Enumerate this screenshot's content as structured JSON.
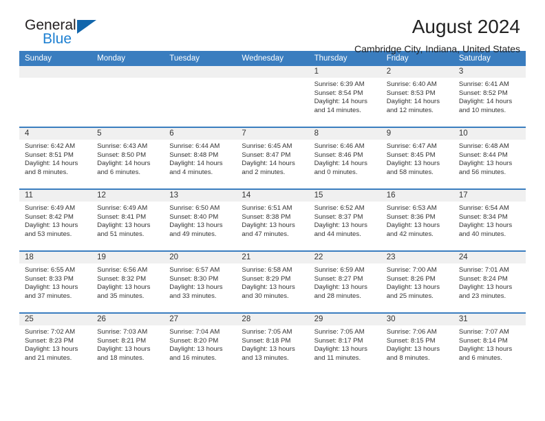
{
  "brand": {
    "name_part1": "General",
    "name_part2": "Blue",
    "flag_color": "#1266ab",
    "blue_color": "#1c7fd1"
  },
  "header": {
    "title": "August 2024",
    "subtitle": "Cambridge City, Indiana, United States",
    "header_bg": "#3a7dbf",
    "header_text_color": "#ffffff"
  },
  "weekday_headers": [
    "Sunday",
    "Monday",
    "Tuesday",
    "Wednesday",
    "Thursday",
    "Friday",
    "Saturday"
  ],
  "weeks": [
    [
      {
        "day": "",
        "sunrise": "",
        "sunset": "",
        "daylight_line1": "",
        "daylight_line2": ""
      },
      {
        "day": "",
        "sunrise": "",
        "sunset": "",
        "daylight_line1": "",
        "daylight_line2": ""
      },
      {
        "day": "",
        "sunrise": "",
        "sunset": "",
        "daylight_line1": "",
        "daylight_line2": ""
      },
      {
        "day": "",
        "sunrise": "",
        "sunset": "",
        "daylight_line1": "",
        "daylight_line2": ""
      },
      {
        "day": "1",
        "sunrise": "Sunrise: 6:39 AM",
        "sunset": "Sunset: 8:54 PM",
        "daylight_line1": "Daylight: 14 hours",
        "daylight_line2": "and 14 minutes."
      },
      {
        "day": "2",
        "sunrise": "Sunrise: 6:40 AM",
        "sunset": "Sunset: 8:53 PM",
        "daylight_line1": "Daylight: 14 hours",
        "daylight_line2": "and 12 minutes."
      },
      {
        "day": "3",
        "sunrise": "Sunrise: 6:41 AM",
        "sunset": "Sunset: 8:52 PM",
        "daylight_line1": "Daylight: 14 hours",
        "daylight_line2": "and 10 minutes."
      }
    ],
    [
      {
        "day": "4",
        "sunrise": "Sunrise: 6:42 AM",
        "sunset": "Sunset: 8:51 PM",
        "daylight_line1": "Daylight: 14 hours",
        "daylight_line2": "and 8 minutes."
      },
      {
        "day": "5",
        "sunrise": "Sunrise: 6:43 AM",
        "sunset": "Sunset: 8:50 PM",
        "daylight_line1": "Daylight: 14 hours",
        "daylight_line2": "and 6 minutes."
      },
      {
        "day": "6",
        "sunrise": "Sunrise: 6:44 AM",
        "sunset": "Sunset: 8:48 PM",
        "daylight_line1": "Daylight: 14 hours",
        "daylight_line2": "and 4 minutes."
      },
      {
        "day": "7",
        "sunrise": "Sunrise: 6:45 AM",
        "sunset": "Sunset: 8:47 PM",
        "daylight_line1": "Daylight: 14 hours",
        "daylight_line2": "and 2 minutes."
      },
      {
        "day": "8",
        "sunrise": "Sunrise: 6:46 AM",
        "sunset": "Sunset: 8:46 PM",
        "daylight_line1": "Daylight: 14 hours",
        "daylight_line2": "and 0 minutes."
      },
      {
        "day": "9",
        "sunrise": "Sunrise: 6:47 AM",
        "sunset": "Sunset: 8:45 PM",
        "daylight_line1": "Daylight: 13 hours",
        "daylight_line2": "and 58 minutes."
      },
      {
        "day": "10",
        "sunrise": "Sunrise: 6:48 AM",
        "sunset": "Sunset: 8:44 PM",
        "daylight_line1": "Daylight: 13 hours",
        "daylight_line2": "and 56 minutes."
      }
    ],
    [
      {
        "day": "11",
        "sunrise": "Sunrise: 6:49 AM",
        "sunset": "Sunset: 8:42 PM",
        "daylight_line1": "Daylight: 13 hours",
        "daylight_line2": "and 53 minutes."
      },
      {
        "day": "12",
        "sunrise": "Sunrise: 6:49 AM",
        "sunset": "Sunset: 8:41 PM",
        "daylight_line1": "Daylight: 13 hours",
        "daylight_line2": "and 51 minutes."
      },
      {
        "day": "13",
        "sunrise": "Sunrise: 6:50 AM",
        "sunset": "Sunset: 8:40 PM",
        "daylight_line1": "Daylight: 13 hours",
        "daylight_line2": "and 49 minutes."
      },
      {
        "day": "14",
        "sunrise": "Sunrise: 6:51 AM",
        "sunset": "Sunset: 8:38 PM",
        "daylight_line1": "Daylight: 13 hours",
        "daylight_line2": "and 47 minutes."
      },
      {
        "day": "15",
        "sunrise": "Sunrise: 6:52 AM",
        "sunset": "Sunset: 8:37 PM",
        "daylight_line1": "Daylight: 13 hours",
        "daylight_line2": "and 44 minutes."
      },
      {
        "day": "16",
        "sunrise": "Sunrise: 6:53 AM",
        "sunset": "Sunset: 8:36 PM",
        "daylight_line1": "Daylight: 13 hours",
        "daylight_line2": "and 42 minutes."
      },
      {
        "day": "17",
        "sunrise": "Sunrise: 6:54 AM",
        "sunset": "Sunset: 8:34 PM",
        "daylight_line1": "Daylight: 13 hours",
        "daylight_line2": "and 40 minutes."
      }
    ],
    [
      {
        "day": "18",
        "sunrise": "Sunrise: 6:55 AM",
        "sunset": "Sunset: 8:33 PM",
        "daylight_line1": "Daylight: 13 hours",
        "daylight_line2": "and 37 minutes."
      },
      {
        "day": "19",
        "sunrise": "Sunrise: 6:56 AM",
        "sunset": "Sunset: 8:32 PM",
        "daylight_line1": "Daylight: 13 hours",
        "daylight_line2": "and 35 minutes."
      },
      {
        "day": "20",
        "sunrise": "Sunrise: 6:57 AM",
        "sunset": "Sunset: 8:30 PM",
        "daylight_line1": "Daylight: 13 hours",
        "daylight_line2": "and 33 minutes."
      },
      {
        "day": "21",
        "sunrise": "Sunrise: 6:58 AM",
        "sunset": "Sunset: 8:29 PM",
        "daylight_line1": "Daylight: 13 hours",
        "daylight_line2": "and 30 minutes."
      },
      {
        "day": "22",
        "sunrise": "Sunrise: 6:59 AM",
        "sunset": "Sunset: 8:27 PM",
        "daylight_line1": "Daylight: 13 hours",
        "daylight_line2": "and 28 minutes."
      },
      {
        "day": "23",
        "sunrise": "Sunrise: 7:00 AM",
        "sunset": "Sunset: 8:26 PM",
        "daylight_line1": "Daylight: 13 hours",
        "daylight_line2": "and 25 minutes."
      },
      {
        "day": "24",
        "sunrise": "Sunrise: 7:01 AM",
        "sunset": "Sunset: 8:24 PM",
        "daylight_line1": "Daylight: 13 hours",
        "daylight_line2": "and 23 minutes."
      }
    ],
    [
      {
        "day": "25",
        "sunrise": "Sunrise: 7:02 AM",
        "sunset": "Sunset: 8:23 PM",
        "daylight_line1": "Daylight: 13 hours",
        "daylight_line2": "and 21 minutes."
      },
      {
        "day": "26",
        "sunrise": "Sunrise: 7:03 AM",
        "sunset": "Sunset: 8:21 PM",
        "daylight_line1": "Daylight: 13 hours",
        "daylight_line2": "and 18 minutes."
      },
      {
        "day": "27",
        "sunrise": "Sunrise: 7:04 AM",
        "sunset": "Sunset: 8:20 PM",
        "daylight_line1": "Daylight: 13 hours",
        "daylight_line2": "and 16 minutes."
      },
      {
        "day": "28",
        "sunrise": "Sunrise: 7:05 AM",
        "sunset": "Sunset: 8:18 PM",
        "daylight_line1": "Daylight: 13 hours",
        "daylight_line2": "and 13 minutes."
      },
      {
        "day": "29",
        "sunrise": "Sunrise: 7:05 AM",
        "sunset": "Sunset: 8:17 PM",
        "daylight_line1": "Daylight: 13 hours",
        "daylight_line2": "and 11 minutes."
      },
      {
        "day": "30",
        "sunrise": "Sunrise: 7:06 AM",
        "sunset": "Sunset: 8:15 PM",
        "daylight_line1": "Daylight: 13 hours",
        "daylight_line2": "and 8 minutes."
      },
      {
        "day": "31",
        "sunrise": "Sunrise: 7:07 AM",
        "sunset": "Sunset: 8:14 PM",
        "daylight_line1": "Daylight: 13 hours",
        "daylight_line2": "and 6 minutes."
      }
    ]
  ]
}
